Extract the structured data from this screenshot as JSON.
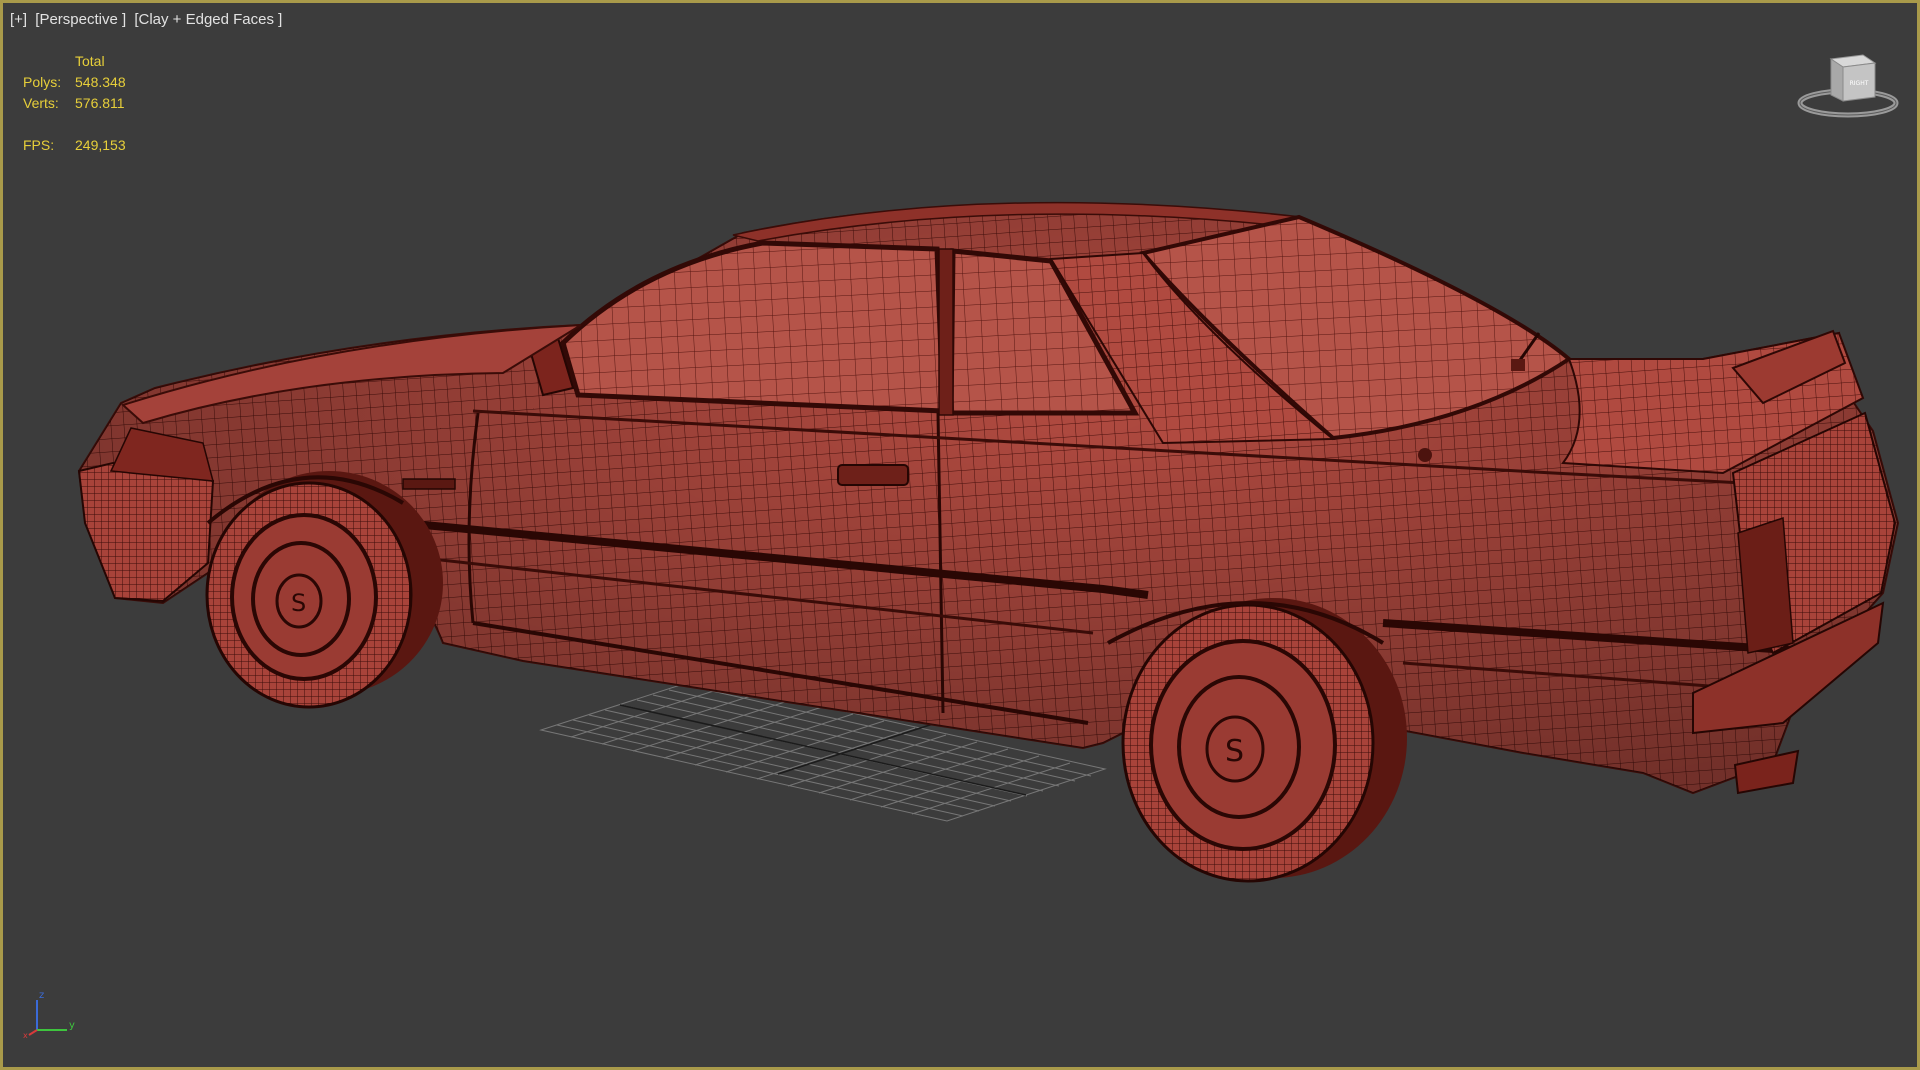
{
  "viewport": {
    "labels": {
      "plus": "[+]",
      "view": "[Perspective ]",
      "shading": "[Clay + Edged Faces ]"
    },
    "stats": {
      "header": "Total",
      "polys_label": "Polys:",
      "polys_value": "548.348",
      "verts_label": "Verts:",
      "verts_value": "576.811",
      "fps_label": "FPS:",
      "fps_value": "249,153"
    },
    "viewcube": {
      "face_label": "RIGHT"
    },
    "axis": {
      "z": "z",
      "y": "y",
      "x": "x"
    }
  },
  "colors": {
    "viewport_border": "#a99a4a",
    "background": "#3c3c3c",
    "stats_text": "#e7cf3a",
    "label_text": "#e2e2e2",
    "clay": "#b5473d",
    "wire": "#4a100c"
  }
}
